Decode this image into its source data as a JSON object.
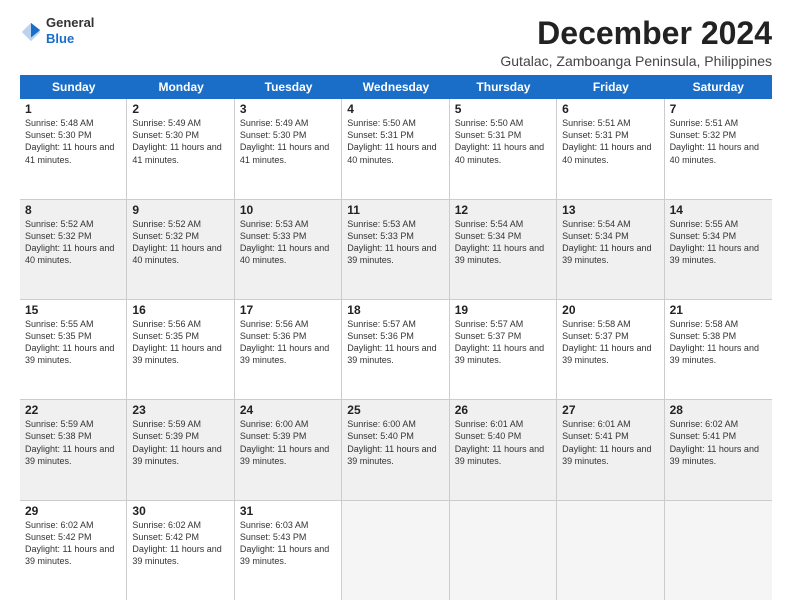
{
  "logo": {
    "text_general": "General",
    "text_blue": "Blue"
  },
  "title": "December 2024",
  "subtitle": "Gutalac, Zamboanga Peninsula, Philippines",
  "header_days": [
    "Sunday",
    "Monday",
    "Tuesday",
    "Wednesday",
    "Thursday",
    "Friday",
    "Saturday"
  ],
  "weeks": [
    [
      {
        "day": "1",
        "sunrise": "Sunrise: 5:48 AM",
        "sunset": "Sunset: 5:30 PM",
        "daylight": "Daylight: 11 hours and 41 minutes.",
        "shaded": false
      },
      {
        "day": "2",
        "sunrise": "Sunrise: 5:49 AM",
        "sunset": "Sunset: 5:30 PM",
        "daylight": "Daylight: 11 hours and 41 minutes.",
        "shaded": false
      },
      {
        "day": "3",
        "sunrise": "Sunrise: 5:49 AM",
        "sunset": "Sunset: 5:30 PM",
        "daylight": "Daylight: 11 hours and 41 minutes.",
        "shaded": false
      },
      {
        "day": "4",
        "sunrise": "Sunrise: 5:50 AM",
        "sunset": "Sunset: 5:31 PM",
        "daylight": "Daylight: 11 hours and 40 minutes.",
        "shaded": false
      },
      {
        "day": "5",
        "sunrise": "Sunrise: 5:50 AM",
        "sunset": "Sunset: 5:31 PM",
        "daylight": "Daylight: 11 hours and 40 minutes.",
        "shaded": false
      },
      {
        "day": "6",
        "sunrise": "Sunrise: 5:51 AM",
        "sunset": "Sunset: 5:31 PM",
        "daylight": "Daylight: 11 hours and 40 minutes.",
        "shaded": false
      },
      {
        "day": "7",
        "sunrise": "Sunrise: 5:51 AM",
        "sunset": "Sunset: 5:32 PM",
        "daylight": "Daylight: 11 hours and 40 minutes.",
        "shaded": false
      }
    ],
    [
      {
        "day": "8",
        "sunrise": "Sunrise: 5:52 AM",
        "sunset": "Sunset: 5:32 PM",
        "daylight": "Daylight: 11 hours and 40 minutes.",
        "shaded": true
      },
      {
        "day": "9",
        "sunrise": "Sunrise: 5:52 AM",
        "sunset": "Sunset: 5:32 PM",
        "daylight": "Daylight: 11 hours and 40 minutes.",
        "shaded": true
      },
      {
        "day": "10",
        "sunrise": "Sunrise: 5:53 AM",
        "sunset": "Sunset: 5:33 PM",
        "daylight": "Daylight: 11 hours and 40 minutes.",
        "shaded": true
      },
      {
        "day": "11",
        "sunrise": "Sunrise: 5:53 AM",
        "sunset": "Sunset: 5:33 PM",
        "daylight": "Daylight: 11 hours and 39 minutes.",
        "shaded": true
      },
      {
        "day": "12",
        "sunrise": "Sunrise: 5:54 AM",
        "sunset": "Sunset: 5:34 PM",
        "daylight": "Daylight: 11 hours and 39 minutes.",
        "shaded": true
      },
      {
        "day": "13",
        "sunrise": "Sunrise: 5:54 AM",
        "sunset": "Sunset: 5:34 PM",
        "daylight": "Daylight: 11 hours and 39 minutes.",
        "shaded": true
      },
      {
        "day": "14",
        "sunrise": "Sunrise: 5:55 AM",
        "sunset": "Sunset: 5:34 PM",
        "daylight": "Daylight: 11 hours and 39 minutes.",
        "shaded": true
      }
    ],
    [
      {
        "day": "15",
        "sunrise": "Sunrise: 5:55 AM",
        "sunset": "Sunset: 5:35 PM",
        "daylight": "Daylight: 11 hours and 39 minutes.",
        "shaded": false
      },
      {
        "day": "16",
        "sunrise": "Sunrise: 5:56 AM",
        "sunset": "Sunset: 5:35 PM",
        "daylight": "Daylight: 11 hours and 39 minutes.",
        "shaded": false
      },
      {
        "day": "17",
        "sunrise": "Sunrise: 5:56 AM",
        "sunset": "Sunset: 5:36 PM",
        "daylight": "Daylight: 11 hours and 39 minutes.",
        "shaded": false
      },
      {
        "day": "18",
        "sunrise": "Sunrise: 5:57 AM",
        "sunset": "Sunset: 5:36 PM",
        "daylight": "Daylight: 11 hours and 39 minutes.",
        "shaded": false
      },
      {
        "day": "19",
        "sunrise": "Sunrise: 5:57 AM",
        "sunset": "Sunset: 5:37 PM",
        "daylight": "Daylight: 11 hours and 39 minutes.",
        "shaded": false
      },
      {
        "day": "20",
        "sunrise": "Sunrise: 5:58 AM",
        "sunset": "Sunset: 5:37 PM",
        "daylight": "Daylight: 11 hours and 39 minutes.",
        "shaded": false
      },
      {
        "day": "21",
        "sunrise": "Sunrise: 5:58 AM",
        "sunset": "Sunset: 5:38 PM",
        "daylight": "Daylight: 11 hours and 39 minutes.",
        "shaded": false
      }
    ],
    [
      {
        "day": "22",
        "sunrise": "Sunrise: 5:59 AM",
        "sunset": "Sunset: 5:38 PM",
        "daylight": "Daylight: 11 hours and 39 minutes.",
        "shaded": true
      },
      {
        "day": "23",
        "sunrise": "Sunrise: 5:59 AM",
        "sunset": "Sunset: 5:39 PM",
        "daylight": "Daylight: 11 hours and 39 minutes.",
        "shaded": true
      },
      {
        "day": "24",
        "sunrise": "Sunrise: 6:00 AM",
        "sunset": "Sunset: 5:39 PM",
        "daylight": "Daylight: 11 hours and 39 minutes.",
        "shaded": true
      },
      {
        "day": "25",
        "sunrise": "Sunrise: 6:00 AM",
        "sunset": "Sunset: 5:40 PM",
        "daylight": "Daylight: 11 hours and 39 minutes.",
        "shaded": true
      },
      {
        "day": "26",
        "sunrise": "Sunrise: 6:01 AM",
        "sunset": "Sunset: 5:40 PM",
        "daylight": "Daylight: 11 hours and 39 minutes.",
        "shaded": true
      },
      {
        "day": "27",
        "sunrise": "Sunrise: 6:01 AM",
        "sunset": "Sunset: 5:41 PM",
        "daylight": "Daylight: 11 hours and 39 minutes.",
        "shaded": true
      },
      {
        "day": "28",
        "sunrise": "Sunrise: 6:02 AM",
        "sunset": "Sunset: 5:41 PM",
        "daylight": "Daylight: 11 hours and 39 minutes.",
        "shaded": true
      }
    ],
    [
      {
        "day": "29",
        "sunrise": "Sunrise: 6:02 AM",
        "sunset": "Sunset: 5:42 PM",
        "daylight": "Daylight: 11 hours and 39 minutes.",
        "shaded": false
      },
      {
        "day": "30",
        "sunrise": "Sunrise: 6:02 AM",
        "sunset": "Sunset: 5:42 PM",
        "daylight": "Daylight: 11 hours and 39 minutes.",
        "shaded": false
      },
      {
        "day": "31",
        "sunrise": "Sunrise: 6:03 AM",
        "sunset": "Sunset: 5:43 PM",
        "daylight": "Daylight: 11 hours and 39 minutes.",
        "shaded": false
      },
      {
        "day": "",
        "sunrise": "",
        "sunset": "",
        "daylight": "",
        "shaded": false,
        "empty": true
      },
      {
        "day": "",
        "sunrise": "",
        "sunset": "",
        "daylight": "",
        "shaded": false,
        "empty": true
      },
      {
        "day": "",
        "sunrise": "",
        "sunset": "",
        "daylight": "",
        "shaded": false,
        "empty": true
      },
      {
        "day": "",
        "sunrise": "",
        "sunset": "",
        "daylight": "",
        "shaded": false,
        "empty": true
      }
    ]
  ]
}
